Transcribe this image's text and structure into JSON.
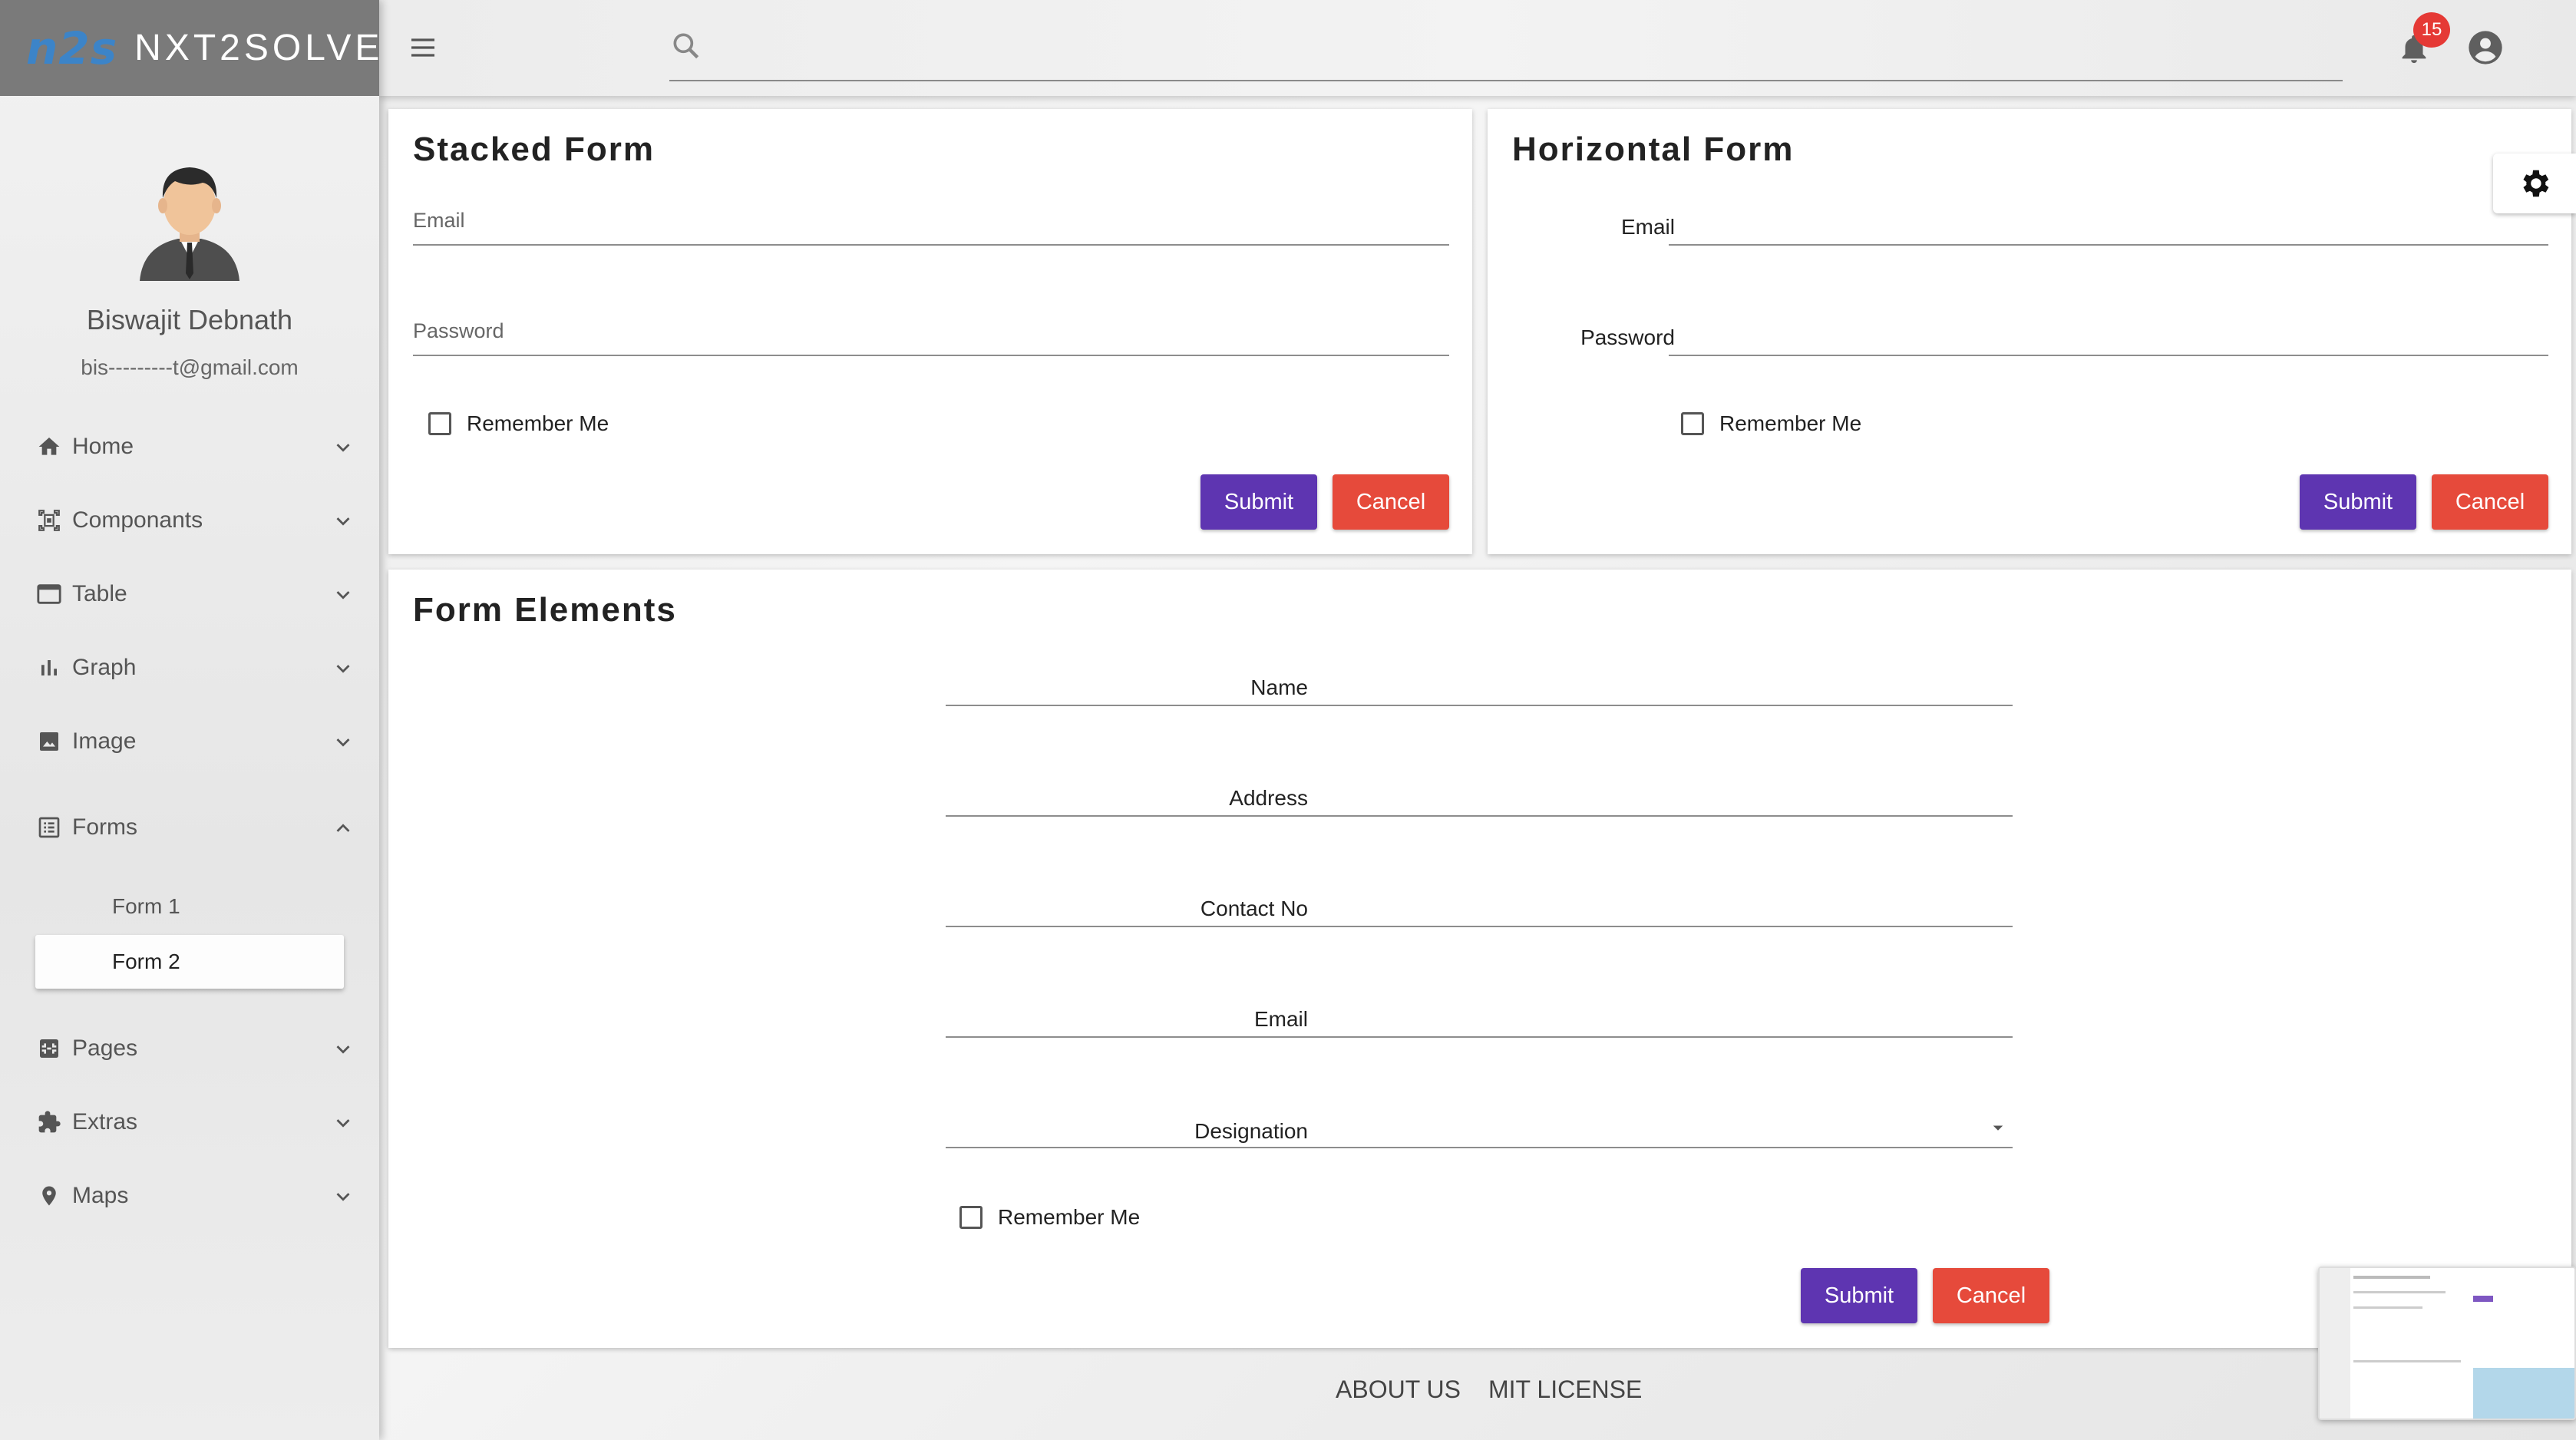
{
  "brand": {
    "logo": "n2s",
    "name": "NXT2SOLVE"
  },
  "user": {
    "name": "Biswajit Debnath",
    "email": "bis---------t@gmail.com"
  },
  "sidebar": {
    "items": [
      {
        "label": "Home",
        "icon": "home-icon"
      },
      {
        "label": "Componants",
        "icon": "components-icon"
      },
      {
        "label": "Table",
        "icon": "table-icon"
      },
      {
        "label": "Graph",
        "icon": "graph-icon"
      },
      {
        "label": "Image",
        "icon": "image-icon"
      },
      {
        "label": "Forms",
        "icon": "forms-icon",
        "expanded": true
      },
      {
        "label": "Pages",
        "icon": "pages-icon"
      },
      {
        "label": "Extras",
        "icon": "extras-icon"
      },
      {
        "label": "Maps",
        "icon": "map-pin-icon"
      }
    ],
    "forms_sub": [
      {
        "label": "Form 1",
        "active": false
      },
      {
        "label": "Form 2",
        "active": true
      }
    ]
  },
  "topbar": {
    "search_placeholder": "",
    "notification_count": "15"
  },
  "stacked_form": {
    "title": "Stacked Form",
    "email_label": "Email",
    "password_label": "Password",
    "remember_label": "Remember Me",
    "submit": "Submit",
    "cancel": "Cancel"
  },
  "horizontal_form": {
    "title": "Horizontal Form",
    "email_label": "Email",
    "password_label": "Password",
    "remember_label": "Remember Me",
    "submit": "Submit",
    "cancel": "Cancel"
  },
  "form_elements": {
    "title": "Form Elements",
    "name_label": "Name",
    "address_label": "Address",
    "contact_label": "Contact No",
    "email_label": "Email",
    "designation_label": "Designation",
    "designation_value": "",
    "remember_label": "Remember Me",
    "submit": "Submit",
    "cancel": "Cancel"
  },
  "footer": {
    "about": "ABOUT US",
    "license": "MIT LICENSE"
  },
  "colors": {
    "primary": "#5e35b1",
    "danger": "#e64a3b",
    "brand_blue": "#3c84c8",
    "badge": "#e53935"
  }
}
